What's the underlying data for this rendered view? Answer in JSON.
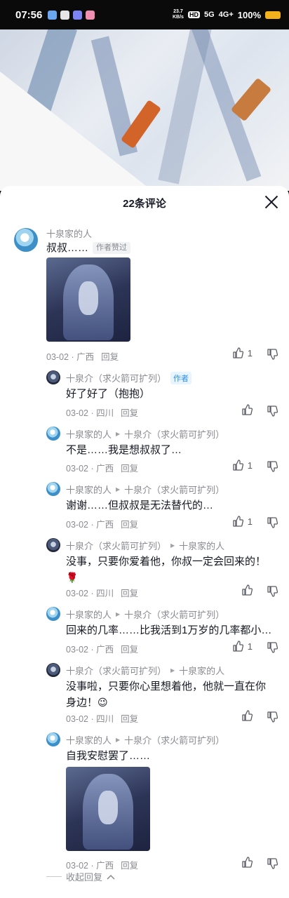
{
  "status_bar": {
    "time": "07:56",
    "net_speed": "23.7",
    "net_unit": "KB/s",
    "hd": "HD",
    "sig5g": "5G",
    "sig4g": "4G+",
    "battery": "100%",
    "battery_color": "#f3b21b"
  },
  "comments_header": {
    "title": "22条评论"
  },
  "comments": [
    {
      "user": "十泉家的人",
      "text": "叔叔……",
      "badge": "作者赞过",
      "date": "03-02",
      "location": "广西",
      "reply_label": "回复",
      "likes": "1"
    }
  ],
  "replies": [
    {
      "user": "十泉介（求火箭可扩列）",
      "tag": "作者",
      "text": "好了好了（抱抱）",
      "date": "03-02",
      "location": "四川",
      "reply_label": "回复",
      "likes": ""
    },
    {
      "user": "十泉家的人",
      "target": "十泉介（求火箭可扩列）",
      "text": "不是……我是想叔叔了…",
      "date": "03-02",
      "location": "广西",
      "reply_label": "回复",
      "likes": "1"
    },
    {
      "user": "十泉家的人",
      "target": "十泉介（求火箭可扩列）",
      "text": "谢谢……但叔叔是无法替代的…",
      "date": "03-02",
      "location": "广西",
      "reply_label": "回复",
      "likes": "1"
    },
    {
      "user": "十泉介（求火箭可扩列）",
      "target": "十泉家的人",
      "text": "没事，只要你爱着他，你叔一定会回来的！",
      "emoji": "🌹",
      "date": "03-02",
      "location": "四川",
      "reply_label": "回复",
      "likes": ""
    },
    {
      "user": "十泉家的人",
      "target": "十泉介（求火箭可扩列）",
      "text": "回来的几率……比我活到1万岁的几率都小…",
      "date": "03-02",
      "location": "广西",
      "reply_label": "回复",
      "likes": "1"
    },
    {
      "user": "十泉介（求火箭可扩列）",
      "target": "十泉家的人",
      "text": "没事啦，只要你心里想着他，他就一直在你",
      "text2": "身边！",
      "emoji": "😉",
      "date": "03-02",
      "location": "四川",
      "reply_label": "回复",
      "likes": ""
    },
    {
      "user": "十泉家的人",
      "target": "十泉介（求火箭可扩列）",
      "text": "自我安慰罢了……",
      "date": "03-02",
      "location": "广西",
      "reply_label": "回复",
      "likes": ""
    }
  ],
  "collapse_label": "收起回复"
}
